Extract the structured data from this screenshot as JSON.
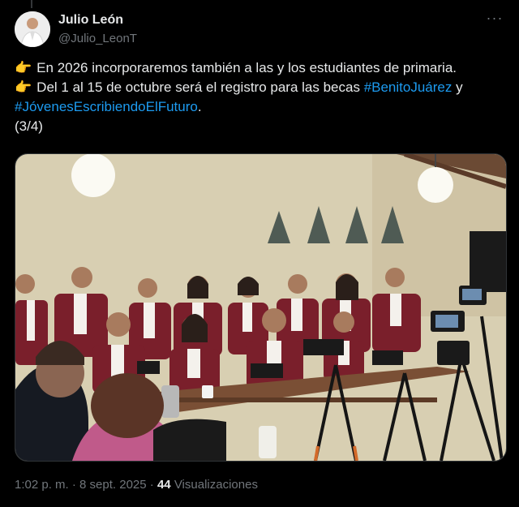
{
  "author": {
    "name": "Julio León",
    "handle": "@Julio_LeonT"
  },
  "tweet": {
    "line1_emoji": "👉",
    "line1_text": "En 2026 incorporaremos también a las y los estudiantes de primaria.",
    "line2_emoji": "👉",
    "line2_text": "Del 1 al 15 de octubre será el registro para las becas ",
    "hashtag1": "#BenitoJuárez",
    "line2_suffix": " y",
    "hashtag2": "#JóvenesEscribiendoElFuturo",
    "line3_suffix": ".",
    "counter": "(3/4)"
  },
  "media": {
    "icon": "press-conference-photo"
  },
  "meta": {
    "time": "1:02 p. m.",
    "separator": " · ",
    "date": "8 sept. 2025",
    "views_count": "44",
    "views_label": "Visualizaciones"
  },
  "colors": {
    "background": "#000000",
    "text": "#e7e9ea",
    "secondary": "#71767b",
    "link": "#1d9bf0",
    "vest": "#7a1f2b"
  }
}
